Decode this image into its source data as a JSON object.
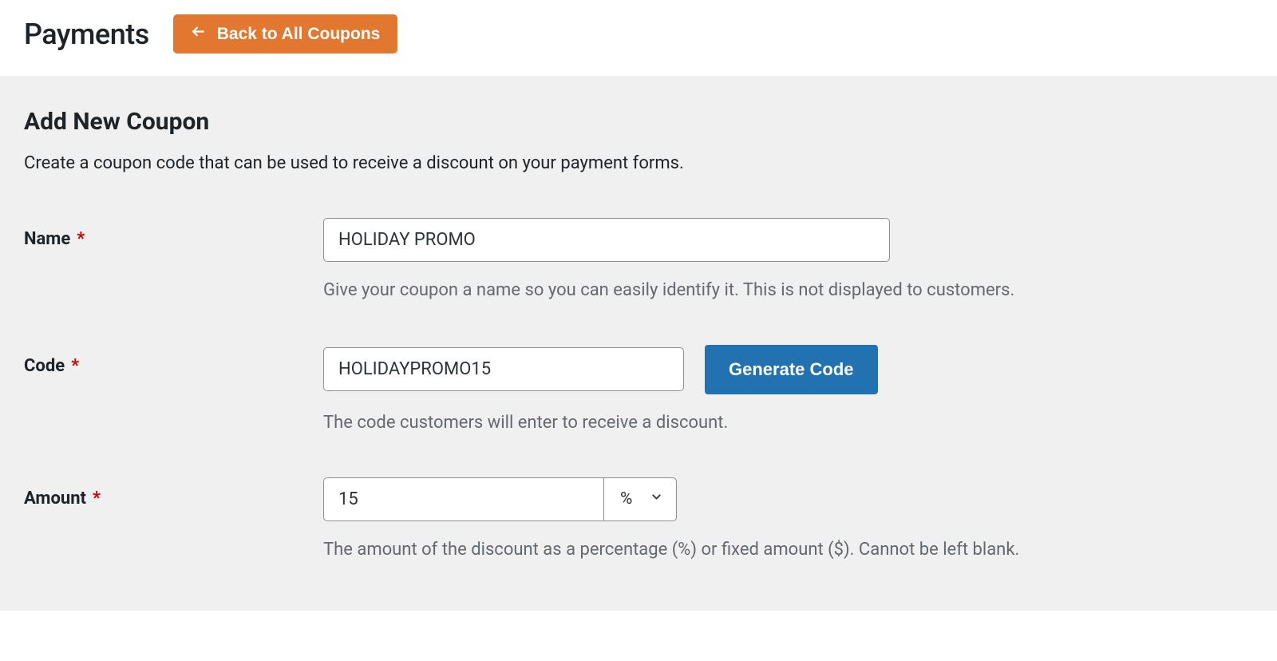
{
  "header": {
    "title": "Payments",
    "back_label": "Back to All Coupons"
  },
  "section": {
    "title": "Add New Coupon",
    "subtitle": "Create a coupon code that can be used to receive a discount on your payment forms."
  },
  "fields": {
    "name": {
      "label": "Name",
      "value": "HOLIDAY PROMO",
      "help": "Give your coupon a name so you can easily identify it. This is not displayed to customers."
    },
    "code": {
      "label": "Code",
      "value": "HOLIDAYPROMO15",
      "generate_label": "Generate Code",
      "help": "The code customers will enter to receive a discount."
    },
    "amount": {
      "label": "Amount",
      "value": "15",
      "unit": "%",
      "help": "The amount of the discount as a percentage (%) or fixed amount ($). Cannot be left blank."
    }
  }
}
